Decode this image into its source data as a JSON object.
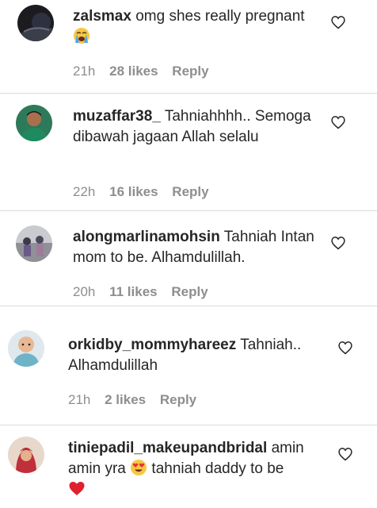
{
  "comments": [
    {
      "username": "zalsmax",
      "text": "omg shes really pregnant",
      "emoji": "loudly-crying-face-emoji",
      "time": "21h",
      "likes": "28 likes",
      "reply": "Reply"
    },
    {
      "username": "muzaffar38_",
      "text": "Tahniahhhh.. Semoga dibawah jagaan Allah selalu",
      "time": "22h",
      "likes": "16 likes",
      "reply": "Reply"
    },
    {
      "username": "alongmarlinamohsin",
      "text": "Tahniah Intan mom to be. Alhamdulillah.",
      "time": "20h",
      "likes": "11 likes",
      "reply": "Reply"
    },
    {
      "username": "orkidby_mommyhareez",
      "text": "Tahniah.. Alhamdulillah",
      "time": "21h",
      "likes": "2 likes",
      "reply": "Reply"
    },
    {
      "username": "tiniepadil_makeupandbridal",
      "text_before": "amin amin yra",
      "emoji_mid": "heart-eyes-emoji",
      "text_after": "tahniah daddy to be",
      "emoji_end": "red-heart-emoji"
    }
  ],
  "icons": {
    "like": "heart-outline-icon"
  },
  "colors": {
    "text": "#262626",
    "secondary": "#8e8e8e",
    "divider": "#dbdbdb"
  }
}
